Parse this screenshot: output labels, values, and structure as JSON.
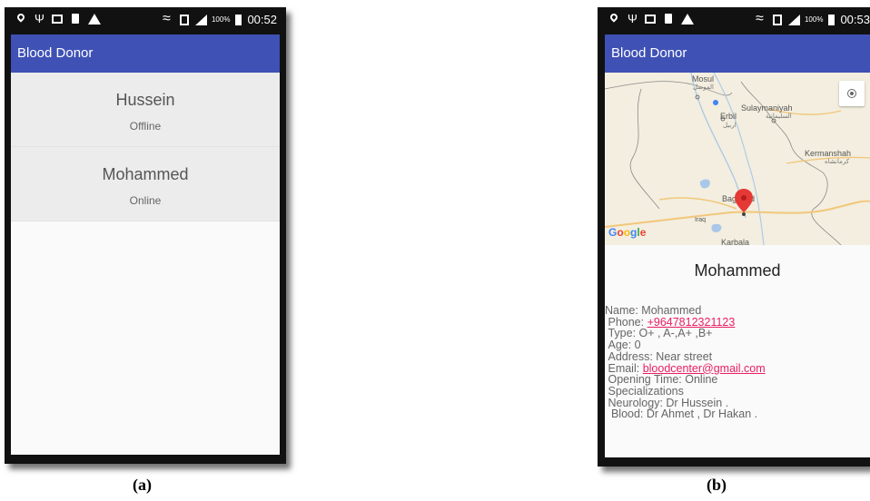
{
  "statusbar_a": {
    "battery_pct": "100%",
    "time": "00:52"
  },
  "statusbar_b": {
    "battery_pct": "100%",
    "time": "00:53"
  },
  "app_title": "Blood Donor",
  "screen_a": {
    "users": [
      {
        "name": "Hussein",
        "status": "Offline"
      },
      {
        "name": "Mohammed",
        "status": "Online"
      }
    ]
  },
  "screen_b": {
    "map": {
      "labels": {
        "mosul": "Mosul",
        "mosul_ar": "الموصل",
        "erbil": "Erbil",
        "erbil_ar": "اربيل",
        "sulaymaniyah": "Sulaymaniyah",
        "sulaymaniyah_ar": "السليمانية",
        "kermanshah": "Kermanshah",
        "kermanshah_ar": "كرمانشاه",
        "baghdad": "Baghdad",
        "iraq": "Iraq",
        "karbala": "Karbala"
      },
      "google_logo": "Google",
      "icon": "my-location-icon",
      "marker_color": "#e53935"
    },
    "title": "Mohammed",
    "details": {
      "name": "Name: Mohammed",
      "phone_label": "Phone: ",
      "phone": "+9647812321123",
      "type": "Type: O+ , A-,A+ ,B+",
      "age": "Age: 0",
      "address": "Address: Near street",
      "email_label": "Email: ",
      "email": "bloodcenter@gmail.com",
      "opening": "Opening Time: Online",
      "specializations": "Specializations",
      "neurology": "Neurology: Dr Hussein .",
      "blood": " Blood: Dr Ahmet , Dr Hakan ."
    },
    "link_color": "#e91e63"
  },
  "captions": {
    "a": "(a)",
    "b": "(b)"
  },
  "colors": {
    "appbar": "#3f51b5",
    "list_item": "#ececec"
  }
}
